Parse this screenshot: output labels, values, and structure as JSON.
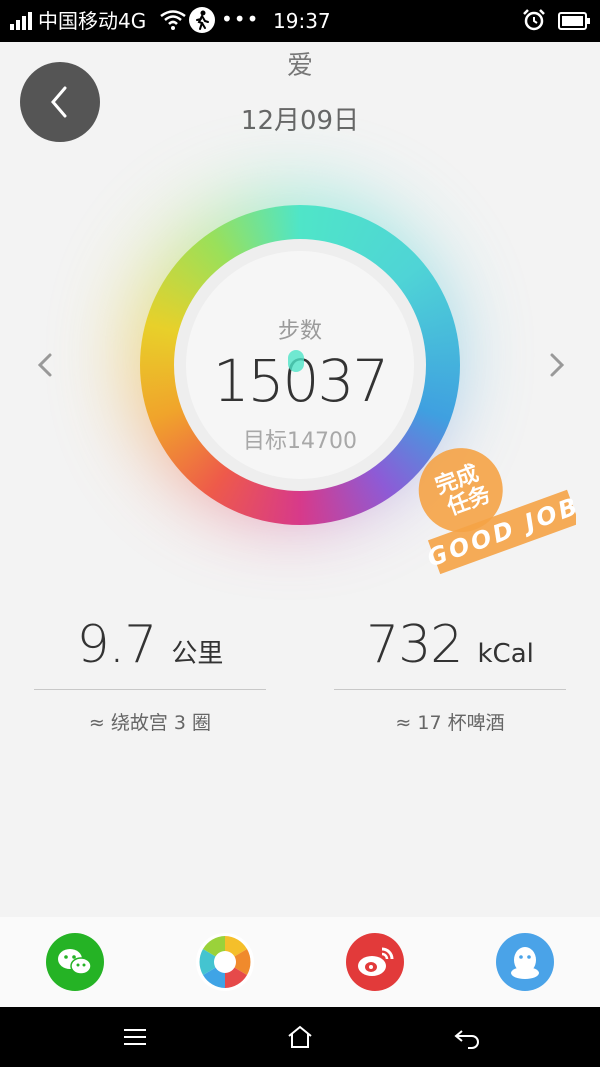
{
  "status_bar": {
    "carrier": "中国移动4G",
    "dots": "•••",
    "time": "19:37"
  },
  "header": {
    "title": "爱",
    "date": "12月09日"
  },
  "ring": {
    "steps_label": "步数",
    "steps_value": "15037",
    "goal_label": "目标14700",
    "progress_fraction": 1.0
  },
  "badge": {
    "line1": "完成",
    "line2": "任务",
    "line3": "GOOD JOB",
    "color": "#f5a346"
  },
  "stats": {
    "distance": {
      "value": "9.7",
      "unit": "公里",
      "equiv": "≈ 绕故宫 3 圈"
    },
    "calories": {
      "value": "732",
      "unit": "kCal",
      "equiv": "≈ 17 杯啤酒"
    }
  },
  "share": [
    {
      "name": "wechat-icon",
      "color": "#25b325"
    },
    {
      "name": "moments-icon",
      "color": "#ffffff"
    },
    {
      "name": "weibo-icon",
      "color": "#e23a3a"
    },
    {
      "name": "qq-icon",
      "color": "#4aa3e8"
    }
  ],
  "colors": {
    "ring_start": "#4fe5c8",
    "ring_mid": "#d73a8a",
    "ring_end": "#e8d02a"
  }
}
